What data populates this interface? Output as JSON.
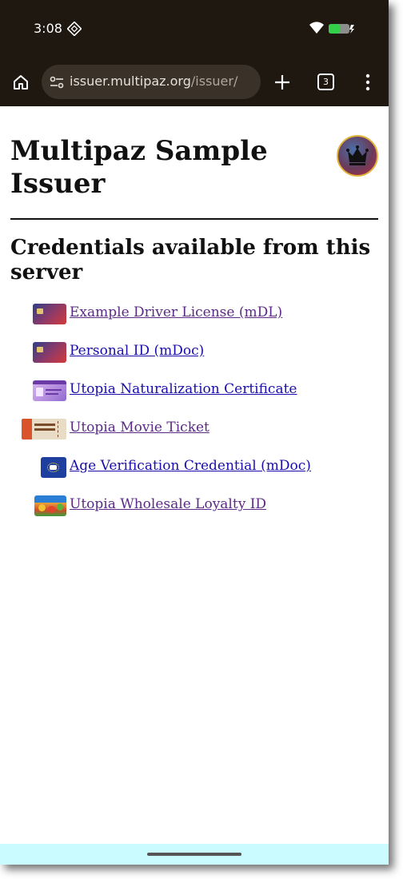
{
  "status": {
    "time": "3:08"
  },
  "browser": {
    "url_host": "issuer.multipaz.org",
    "url_path": "/issuer/",
    "tab_count": "3"
  },
  "page": {
    "title": "Multipaz Sample Issuer",
    "section_heading": "Credentials available from this server",
    "credentials": [
      {
        "label": "Example Driver License (mDL)",
        "icon": "card-icon"
      },
      {
        "label": "Personal ID (mDoc)",
        "icon": "card-icon"
      },
      {
        "label": "Utopia Naturalization Certificate",
        "icon": "certificate-icon"
      },
      {
        "label": "Utopia Movie Ticket",
        "icon": "ticket-icon"
      },
      {
        "label": "Age Verification Credential (mDoc)",
        "icon": "age-card-icon"
      },
      {
        "label": "Utopia Wholesale Loyalty ID",
        "icon": "produce-icon"
      }
    ]
  },
  "colors": {
    "chrome_bg": "#1f1810",
    "link_visited": "#5b2a86",
    "link_unvisited": "#1a0dab",
    "nav_bar": "#c9fbff"
  }
}
